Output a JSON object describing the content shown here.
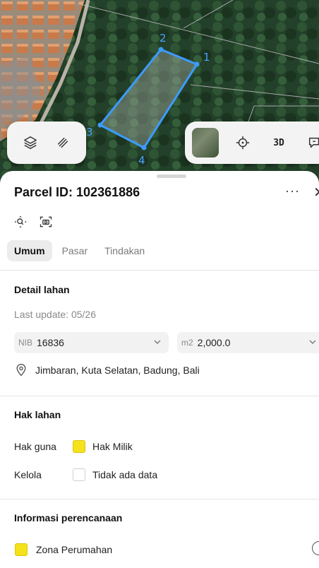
{
  "map": {
    "vertices": [
      {
        "id": "v1",
        "label": "1"
      },
      {
        "id": "v2",
        "label": "2"
      },
      {
        "id": "v3",
        "label": "3"
      },
      {
        "id": "v4",
        "label": "4"
      }
    ],
    "controls_left": [
      {
        "name": "layers-icon"
      },
      {
        "name": "draw-icon"
      }
    ],
    "controls_right": {
      "basemap": "satellite-thumbnail",
      "locate": "crosshair-icon",
      "threed_label": "3D",
      "chat": "chat-icon"
    },
    "colors": {
      "polygon_stroke": "#3d9bff",
      "polygon_fill": "rgba(160,170,160,0.45)",
      "vertex_label": "#4aa3ff"
    }
  },
  "sheet": {
    "title": "Parcel ID: 102361886",
    "more_label": "···",
    "close_label": "✕",
    "tabs": [
      {
        "label": "Umum",
        "active": true
      },
      {
        "label": "Pasar",
        "active": false
      },
      {
        "label": "Tindakan",
        "active": false
      }
    ],
    "detail": {
      "heading": "Detail lahan",
      "last_update": "Last update: 05/26",
      "nib_prefix": "NIB",
      "nib_value": "16836",
      "area_prefix": "m2",
      "area_value": "2,000.0",
      "location": "Jimbaran, Kuta Selatan, Badung, Bali"
    },
    "hak": {
      "heading": "Hak lahan",
      "guna_label": "Hak guna",
      "guna_value": "Hak Milik",
      "guna_color": "#f5e21b",
      "kelola_label": "Kelola",
      "kelola_value": "Tidak ada data",
      "kelola_color": "#ffffff"
    },
    "perencanaan": {
      "heading": "Informasi perencanaan",
      "zona_value": "Zona Perumahan",
      "zona_color": "#f5e21b"
    }
  }
}
